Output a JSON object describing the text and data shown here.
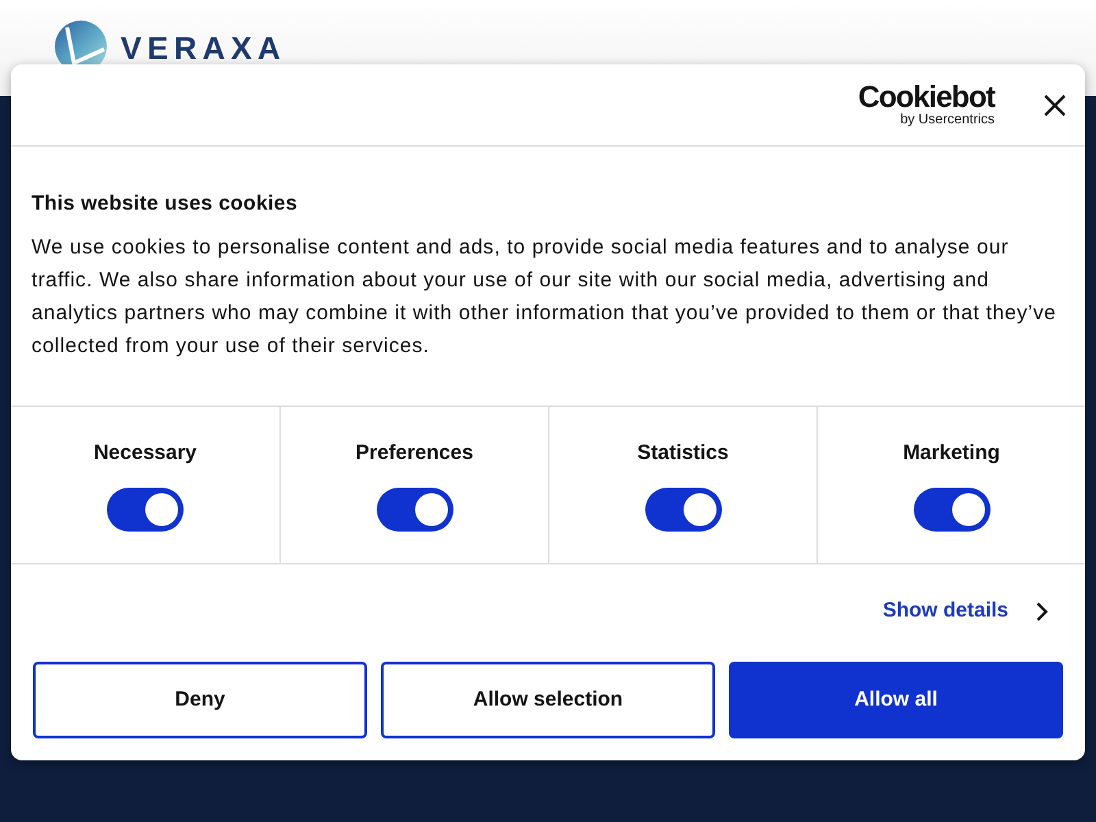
{
  "site_header": {
    "logo_text": "VERAXA"
  },
  "cookie_dialog": {
    "brand": {
      "name": "Cookiebot",
      "tagline": "by Usercentrics"
    },
    "title": "This website uses cookies",
    "body": "We use cookies to personalise content and ads, to provide social media features and to analyse our traffic. We also share information about your use of our site with our social media, advertising and analytics partners who may combine it with other information that you’ve provided to them or that they’ve collected from your use of their services.",
    "categories": [
      {
        "label": "Necessary",
        "on": true
      },
      {
        "label": "Preferences",
        "on": true
      },
      {
        "label": "Statistics",
        "on": true
      },
      {
        "label": "Marketing",
        "on": true
      }
    ],
    "show_details": "Show details",
    "buttons": [
      {
        "label": "Deny",
        "kind": "outline"
      },
      {
        "label": "Allow selection",
        "kind": "outline"
      },
      {
        "label": "Allow all",
        "kind": "primary"
      }
    ]
  }
}
